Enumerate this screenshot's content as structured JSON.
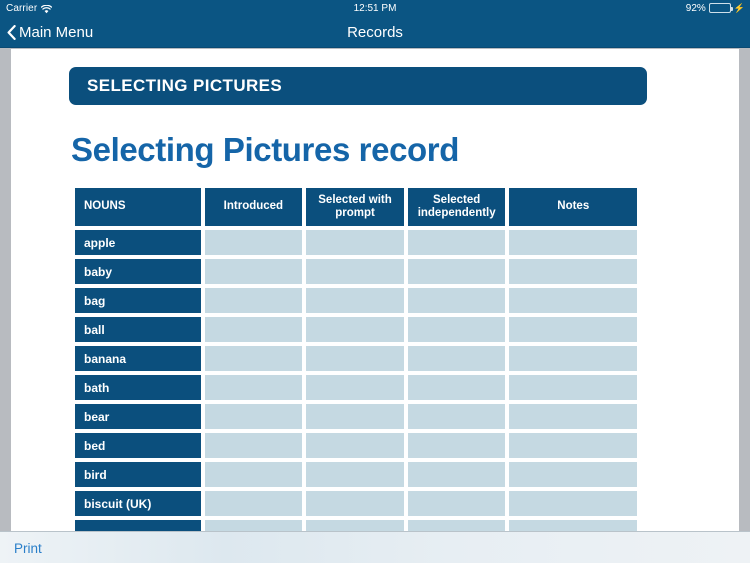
{
  "statusbar": {
    "carrier": "Carrier",
    "wifi_icon": "wifi-icon",
    "time": "12:51 PM",
    "battery_percent": "92%",
    "battery_icon": "battery-charging-icon",
    "charging_bolt": "⚡"
  },
  "navbar": {
    "back_label": "Main Menu",
    "back_icon": "chevron-left-icon",
    "title": "Records"
  },
  "page": {
    "section_banner": "SELECTING PICTURES",
    "record_title": "Selecting Pictures record"
  },
  "table": {
    "columns": [
      "NOUNS",
      "Introduced",
      "Selected with prompt",
      "Selected independently",
      "Notes"
    ],
    "rows": [
      {
        "noun": "apple",
        "introduced": "",
        "selected_with_prompt": "",
        "selected_independently": "",
        "notes": ""
      },
      {
        "noun": "baby",
        "introduced": "",
        "selected_with_prompt": "",
        "selected_independently": "",
        "notes": ""
      },
      {
        "noun": "bag",
        "introduced": "",
        "selected_with_prompt": "",
        "selected_independently": "",
        "notes": ""
      },
      {
        "noun": "ball",
        "introduced": "",
        "selected_with_prompt": "",
        "selected_independently": "",
        "notes": ""
      },
      {
        "noun": "banana",
        "introduced": "",
        "selected_with_prompt": "",
        "selected_independently": "",
        "notes": ""
      },
      {
        "noun": "bath",
        "introduced": "",
        "selected_with_prompt": "",
        "selected_independently": "",
        "notes": ""
      },
      {
        "noun": "bear",
        "introduced": "",
        "selected_with_prompt": "",
        "selected_independently": "",
        "notes": ""
      },
      {
        "noun": "bed",
        "introduced": "",
        "selected_with_prompt": "",
        "selected_independently": "",
        "notes": ""
      },
      {
        "noun": "bird",
        "introduced": "",
        "selected_with_prompt": "",
        "selected_independently": "",
        "notes": ""
      },
      {
        "noun": "biscuit (UK)",
        "introduced": "",
        "selected_with_prompt": "",
        "selected_independently": "",
        "notes": ""
      },
      {
        "noun": "",
        "introduced": "",
        "selected_with_prompt": "",
        "selected_independently": "",
        "notes": ""
      }
    ]
  },
  "toolbar": {
    "print_label": "Print"
  },
  "colors": {
    "navbar_blue": "#0b5583",
    "banner_blue": "#0b4f7d",
    "title_blue": "#1565a8",
    "cell_blue": "#c5d9e2",
    "battery_green": "#4cd964",
    "link_blue": "#2a7fc9",
    "page_surround_gray": "#b8bbc0"
  }
}
